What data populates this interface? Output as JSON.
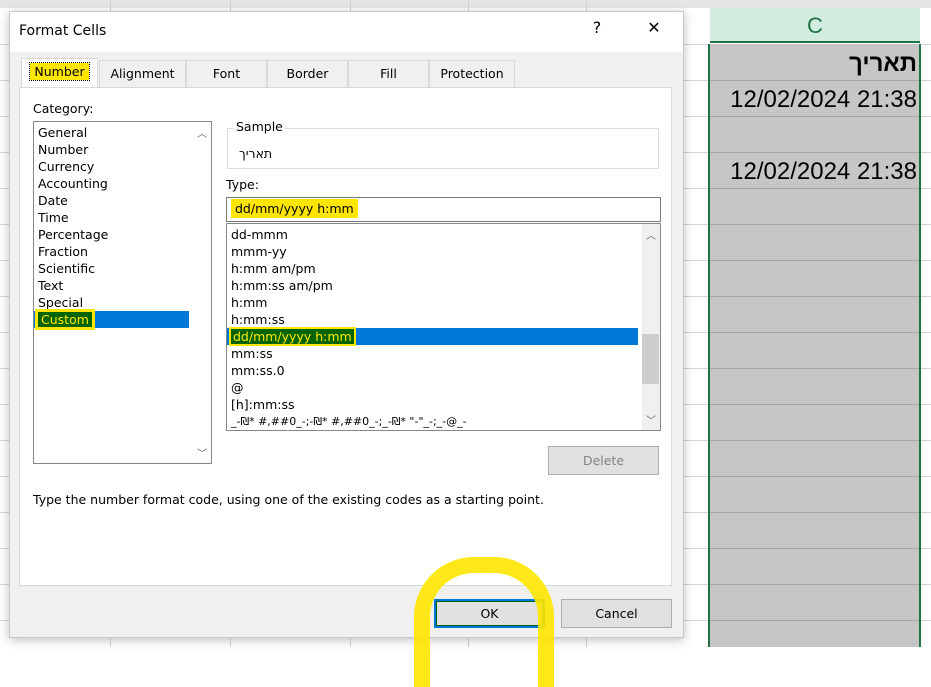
{
  "spreadsheet": {
    "column_header": "C",
    "cells": [
      "תאריך",
      "12/02/2024 21:38",
      "",
      "12/02/2024 21:38"
    ]
  },
  "dialog": {
    "title": "Format Cells",
    "help_label": "?",
    "close_label": "✕",
    "tabs": [
      "Number",
      "Alignment",
      "Font",
      "Border",
      "Fill",
      "Protection"
    ],
    "active_tab": "Number",
    "category_label": "Category:",
    "categories": [
      "General",
      "Number",
      "Currency",
      "Accounting",
      "Date",
      "Time",
      "Percentage",
      "Fraction",
      "Scientific",
      "Text",
      "Special",
      "Custom"
    ],
    "selected_category": "Custom",
    "sample_label": "Sample",
    "sample_value": "תאריך",
    "type_label": "Type:",
    "type_value": "dd/mm/yyyy h:mm",
    "type_list": [
      "dd-mmm",
      "mmm-yy",
      "h:mm am/pm",
      "h:mm:ss am/pm",
      "h:mm",
      "h:mm:ss",
      "dd/mm/yyyy h:mm",
      "mm:ss",
      "mm:ss.0",
      "@",
      "[h]:mm:ss",
      "_-₪* #,##0_-;-₪* #,##0_-;_-₪* \"-\"_-;_-@_-"
    ],
    "selected_type": "dd/mm/yyyy h:mm",
    "delete_label": "Delete",
    "hint": "Type the number format code, using one of the existing codes as a starting point.",
    "ok_label": "OK",
    "cancel_label": "Cancel"
  },
  "colors": {
    "highlight": "#ffe600",
    "selection": "#0078d7",
    "excel_green": "#217346"
  }
}
